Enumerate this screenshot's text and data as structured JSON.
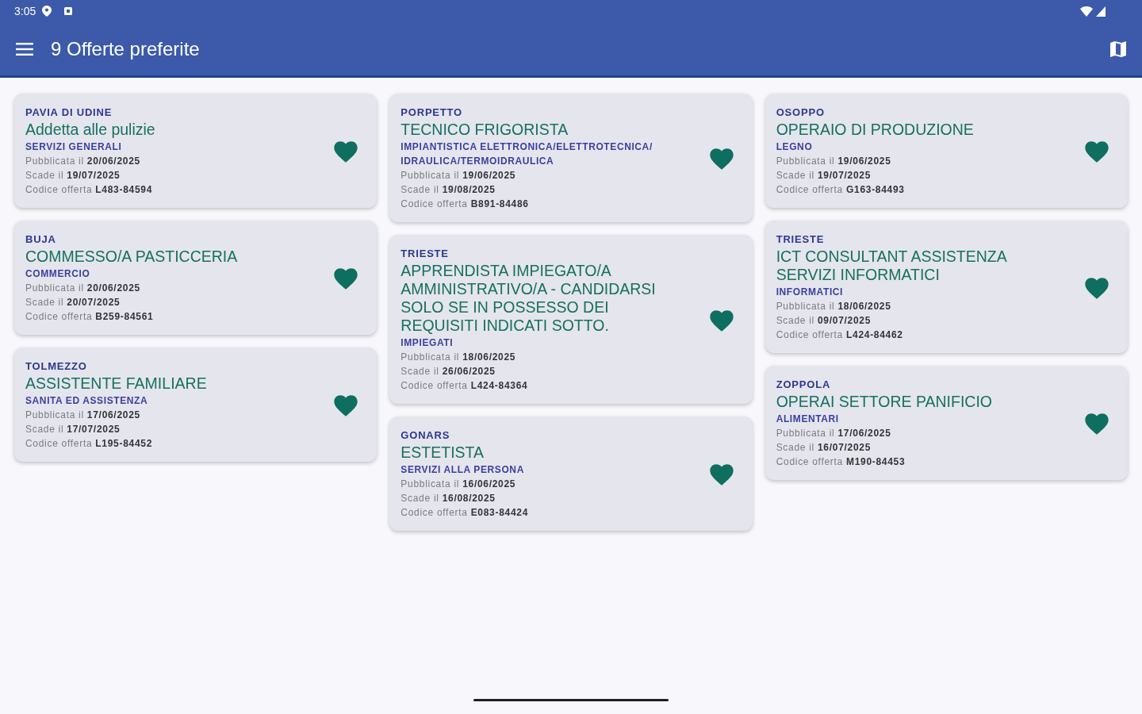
{
  "status_bar": {
    "time": "3:05"
  },
  "toolbar": {
    "title": "9 Offerte preferite"
  },
  "columns": [
    {
      "offers": [
        {
          "location": "PAVIA DI UDINE",
          "title": "Addetta alle pulizie",
          "category": "SERVIZI GENERALI",
          "published": "Pubblicata il **20/06/2025**",
          "expires": "Scade il **19/07/2025**",
          "code": "Codice offerta **L483-84594**",
          "favorite": true
        },
        {
          "location": "BUJA",
          "title": "COMMESSO/A PASTICCERIA",
          "category": "COMMERCIO",
          "published": "Pubblicata il **20/06/2025**",
          "expires": "Scade il **20/07/2025**",
          "code": "Codice offerta **B259-84561**",
          "favorite": true
        },
        {
          "location": "TOLMEZZO",
          "title": "ASSISTENTE FAMILIARE",
          "category": "SANITA ED ASSISTENZA",
          "published": "Pubblicata il **17/06/2025**",
          "expires": "Scade il **17/07/2025**",
          "code": "Codice offerta **L195-84452**",
          "favorite": true
        }
      ]
    },
    {
      "offers": [
        {
          "location": "PORPETTO",
          "title": "TECNICO FRIGORISTA",
          "category": "IMPIANTISTICA ELETTRONICA/ELETTROTECNICA/IDRAULICA/TERMOIDRAULICA",
          "published": "Pubblicata il **19/06/2025**",
          "expires": "Scade il **19/08/2025**",
          "code": "Codice offerta **B891-84486**",
          "favorite": true
        },
        {
          "location": "TRIESTE",
          "title": "APPRENDISTA IMPIEGATO/A AMMINISTRATIVO/A - CANDIDARSI SOLO SE IN POSSESSO DEI REQUISITI INDICATI SOTTO.",
          "category": "IMPIEGATI",
          "published": "Pubblicata il **18/06/2025**",
          "expires": "Scade il **26/06/2025**",
          "code": "Codice offerta **L424-84364**",
          "favorite": true
        },
        {
          "location": "GONARS",
          "title": "ESTETISTA",
          "category": "SERVIZI ALLA PERSONA",
          "published": "Pubblicata il **16/06/2025**",
          "expires": "Scade il **16/08/2025**",
          "code": "Codice offerta **E083-84424**",
          "favorite": true
        }
      ]
    },
    {
      "offers": [
        {
          "location": "OSOPPO",
          "title": "OPERAIO DI PRODUZIONE",
          "category": "LEGNO",
          "published": "Pubblicata il **19/06/2025**",
          "expires": "Scade il **19/07/2025**",
          "code": "Codice offerta **G163-84493**",
          "favorite": true
        },
        {
          "location": "TRIESTE",
          "title": "ICT CONSULTANT ASSISTENZA SERVIZI INFORMATICI",
          "category": "INFORMATICI",
          "published": "Pubblicata il **18/06/2025**",
          "expires": "Scade il **09/07/2025**",
          "code": "Codice offerta **L424-84462**",
          "favorite": true
        },
        {
          "location": "ZOPPOLA",
          "title": "OPERAI SETTORE PANIFICIO",
          "category": "ALIMENTARI",
          "published": "Pubblicata il **17/06/2025**",
          "expires": "Scade il **16/07/2025**",
          "code": "Codice offerta **M190-84453**",
          "favorite": true
        }
      ]
    }
  ]
}
